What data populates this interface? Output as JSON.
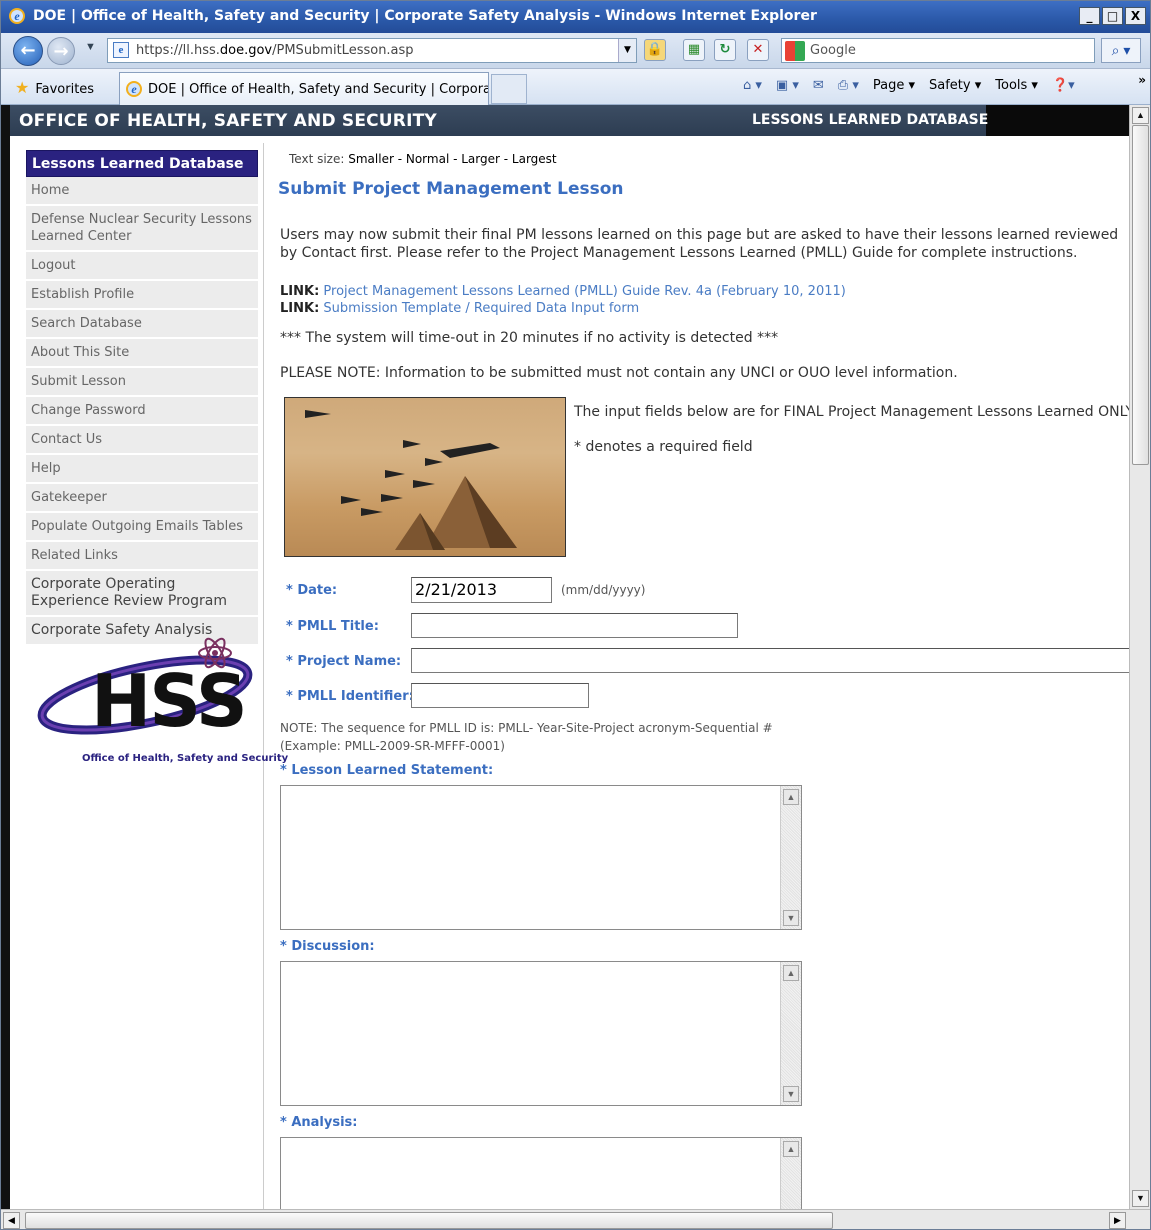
{
  "window": {
    "title": "DOE | Office of Health, Safety and Security | Corporate Safety Analysis - Windows Internet Explorer",
    "min": "_",
    "max": "□",
    "close": "X"
  },
  "address": {
    "url_prefix": "https://ll.hss.",
    "url_domain": "doe.gov",
    "url_path": "/PMSubmitLesson.asp",
    "search_placeholder": "Google"
  },
  "favorites": {
    "label": "Favorites",
    "tab_title": "DOE | Office of Health, Safety and Security | Corpora..."
  },
  "commandbar": {
    "page": "Page",
    "safety": "Safety",
    "tools": "Tools"
  },
  "header": {
    "title": "OFFICE OF HEALTH, SAFETY AND SECURITY",
    "right": "LESSONS LEARNED DATABASE"
  },
  "sidebar": {
    "heading": "Lessons Learned Database",
    "items": [
      {
        "label": "Home"
      },
      {
        "label": "Defense Nuclear Security Lessons Learned Center"
      },
      {
        "label": "Logout"
      },
      {
        "label": "Establish Profile"
      },
      {
        "label": "Search Database"
      },
      {
        "label": "About This Site"
      },
      {
        "label": "Submit Lesson"
      },
      {
        "label": "Change Password"
      },
      {
        "label": "Contact Us"
      },
      {
        "label": "Help"
      },
      {
        "label": "Gatekeeper"
      },
      {
        "label": "Populate Outgoing Emails Tables"
      },
      {
        "label": "Related Links"
      },
      {
        "label": "Corporate Operating Experience Review Program"
      },
      {
        "label": "Corporate Safety Analysis"
      }
    ],
    "logo_text": "HSS",
    "logo_sub": "Office of Health, Safety and Security"
  },
  "main": {
    "text_size_label": "Text size:",
    "text_size_options": [
      "Smaller",
      "Normal",
      "Larger",
      "Largest"
    ],
    "title": "Submit Project Management Lesson",
    "intro": "Users may now submit their final PM lessons learned on this page but are asked to have their lessons learned reviewed by Contact first. Please refer to the Project Management Lessons Learned (PMLL) Guide for complete instructions.",
    "link1_label": "LINK:",
    "link1_text": "Project Management Lessons Learned (PMLL) Guide Rev. 4a (February 10, 2011)",
    "link2_label": "LINK:",
    "link2_text": "Submission Template / Required Data Input form",
    "timeout": "*** The system will time-out in 20 minutes if no activity is detected ***",
    "please_note": "PLEASE NOTE: Information to be submitted must not contain any UNCI or OUO level information.",
    "final_only": "The input fields below are for FINAL Project Management Lessons Learned ONLY",
    "required_note": "* denotes a required field",
    "form": {
      "date_label": "* Date:",
      "date_value": "2/21/2013",
      "date_format": "(mm/dd/yyyy)",
      "title_label": "* PMLL Title:",
      "title_value": "",
      "project_label": "* Project Name:",
      "project_value": "",
      "identifier_label": "* PMLL Identifier:",
      "identifier_value": "",
      "id_note_line1": "NOTE: The sequence for PMLL ID is: PMLL- Year-Site-Project acronym-Sequential #",
      "id_note_line2": "(Example: PMLL-2009-SR-MFFF-0001)",
      "statement_label": "* Lesson Learned Statement:",
      "discussion_label": "* Discussion:",
      "analysis_label": "* Analysis:"
    }
  }
}
